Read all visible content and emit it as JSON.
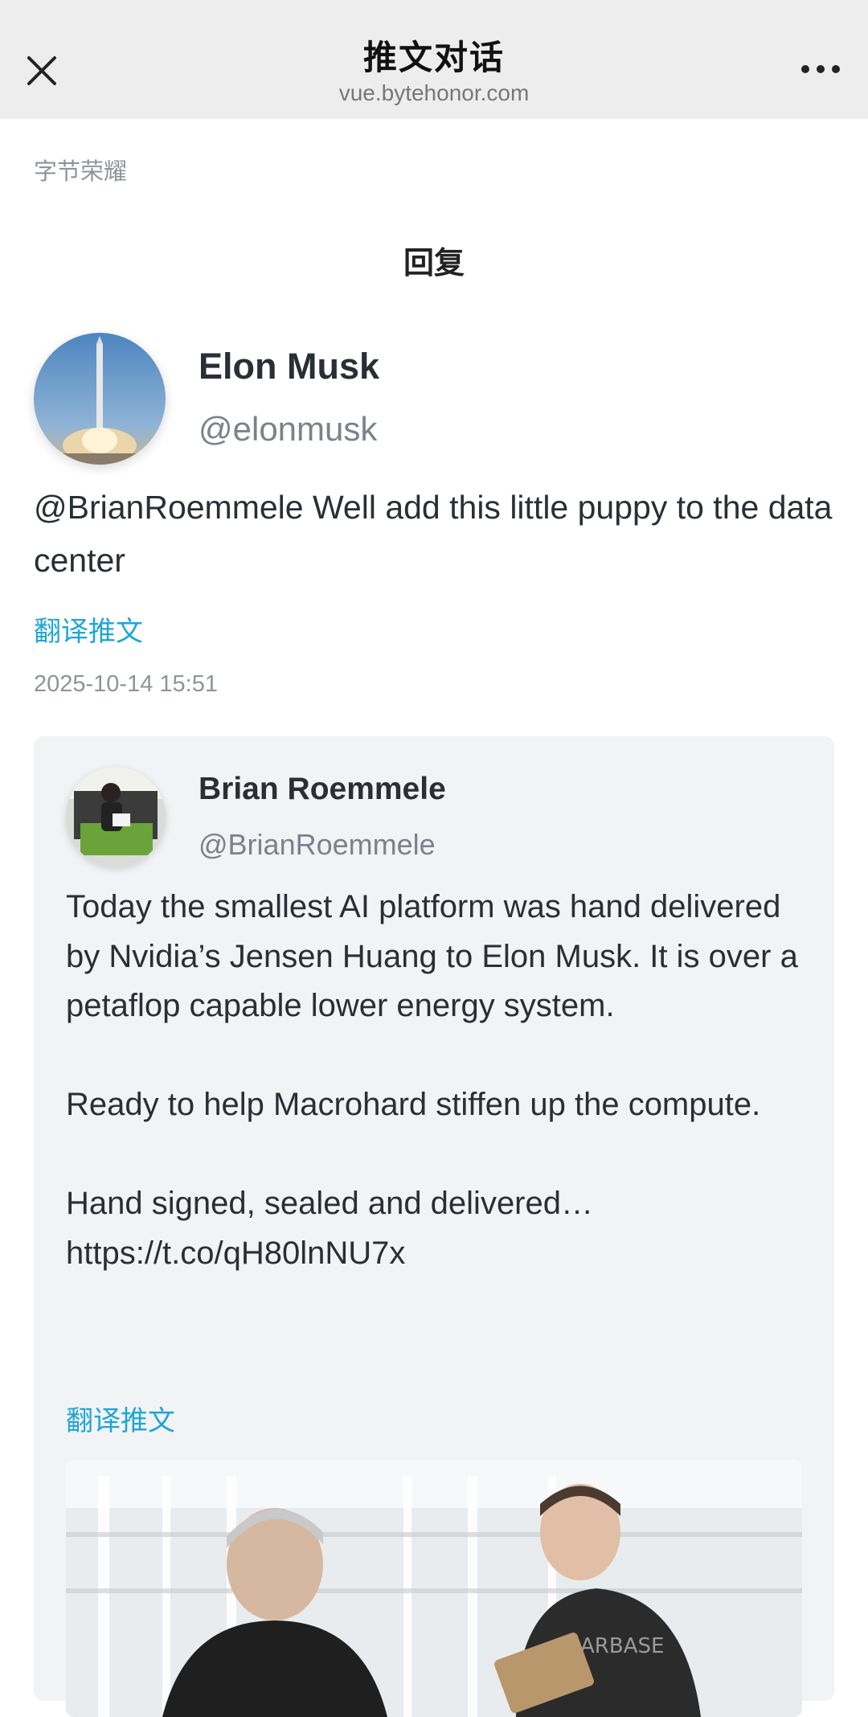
{
  "topbar": {
    "title": "推文对话",
    "url": "vue.bytehonor.com",
    "close_icon": "close-icon",
    "more_icon": "more-dots-icon"
  },
  "site_name": "字节荣耀",
  "section_title": "回复",
  "tweet": {
    "author_name": "Elon Musk",
    "author_handle": "@elonmusk",
    "text": "@BrianRoemmele Well add this little puppy to the data center",
    "translate_label": "翻译推文",
    "timestamp": "2025-10-14 15:51"
  },
  "quoted": {
    "author_name": "Brian Roemmele",
    "author_handle": "@BrianRoemmele",
    "text": "Today the smallest AI platform was hand delivered by Nvidia’s Jensen Huang to Elon Musk.  It is over a petaflop capable lower energy system.\n\nReady to help Macrohard stiffen up the compute.\n\nHand signed, sealed and delivered…\nhttps://t.co/qH80lnNU7x",
    "translate_label": "翻译推文",
    "shirt_text": "ARBASE"
  },
  "colors": {
    "accent": "#1da6d6",
    "topbar": "#ededed",
    "card": "#f2f3f5"
  }
}
